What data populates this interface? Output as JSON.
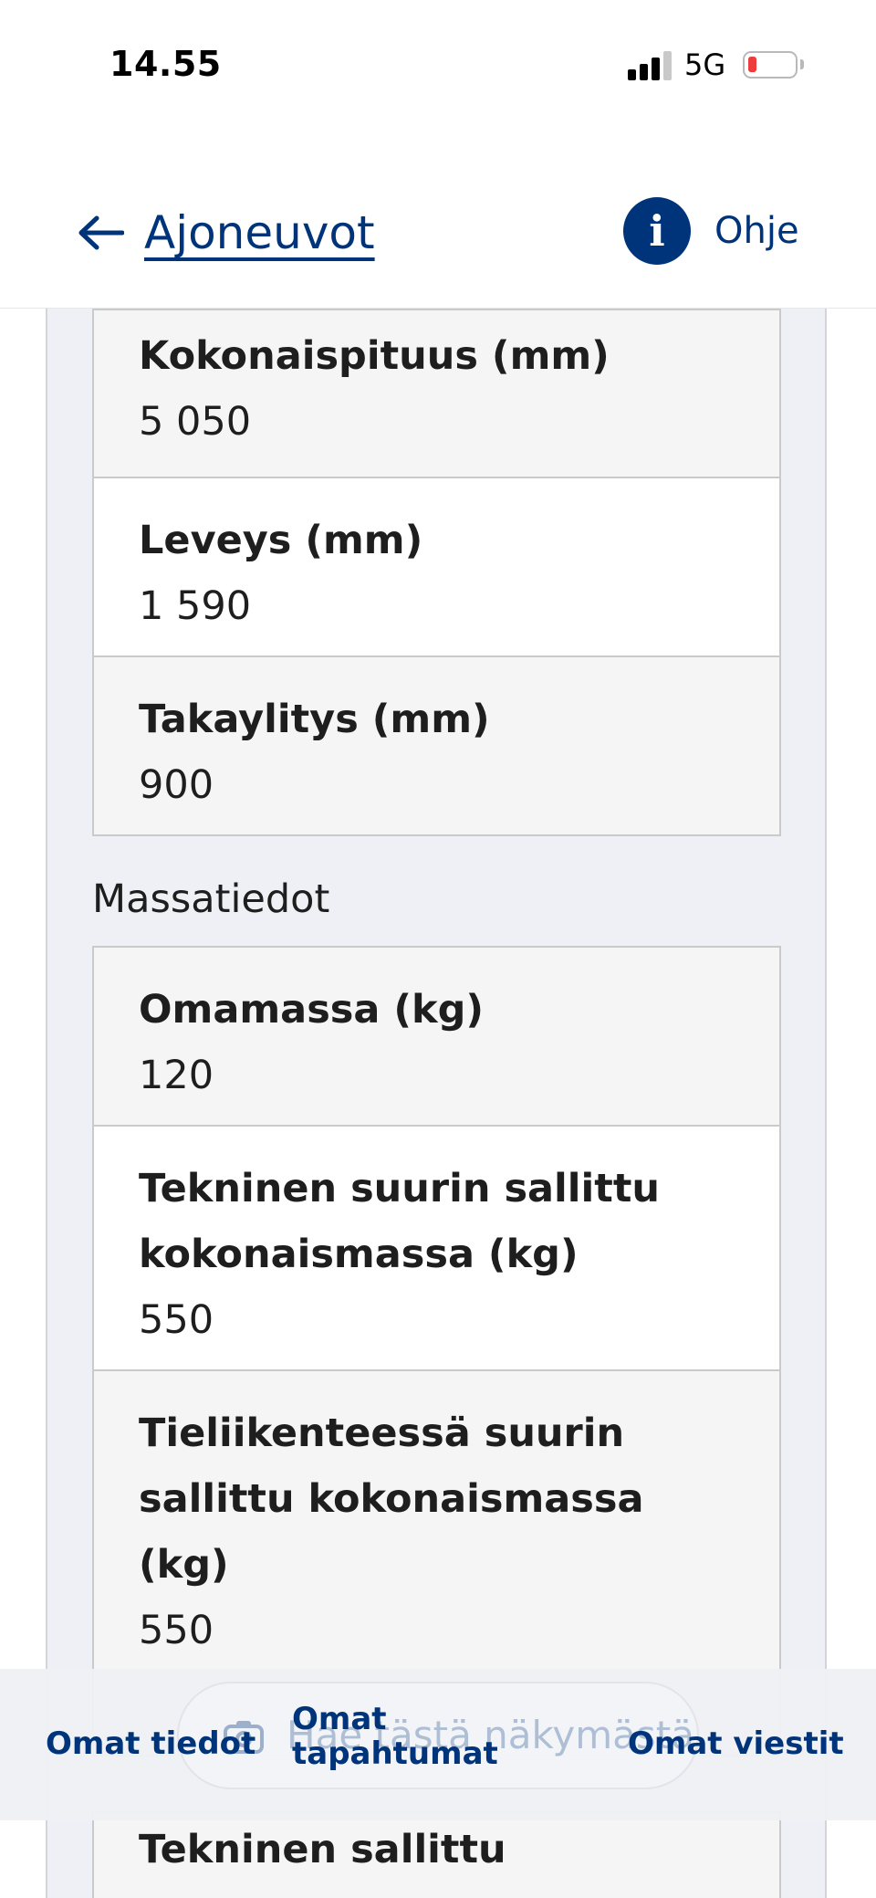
{
  "status_bar": {
    "time": "14.55",
    "network": "5G",
    "battery_level": 0.1,
    "battery_color": "#ee3b3b",
    "signal_bars_filled": 3,
    "signal_bars_total": 4
  },
  "header": {
    "back_label": "Ajoneuvot",
    "back_icon": "arrow-left-icon",
    "help_label": "Ohje",
    "help_icon": "info-icon",
    "accent_color": "#00347a"
  },
  "dimensions_table": {
    "rows": [
      {
        "label": "Kokonaispituus (mm)",
        "value": "5 050"
      },
      {
        "label": "Leveys (mm)",
        "value": "1 590"
      },
      {
        "label": "Takaylitys (mm)",
        "value": "900"
      }
    ]
  },
  "mass_section": {
    "title": "Massatiedot",
    "rows": [
      {
        "label": "Omamassa (kg)",
        "value": "120"
      },
      {
        "label": "Tekninen suurin sallittu kokonaismassa (kg)",
        "value": "550"
      },
      {
        "label": "Tieliikenteessä suurin sallittu kokonaismassa (kg)",
        "value": "550"
      }
    ]
  },
  "next_table": {
    "rows": [
      {
        "label": "Tekninen sallittu"
      }
    ]
  },
  "bottom_nav": {
    "search_placeholder": "Hae tästä näkymästä",
    "search_icon": "camera-search-icon",
    "left_label": "Omat tiedot",
    "center_label_line1": "Omat",
    "center_label_line2": "tapahtumat",
    "right_label": "Omat viestit"
  }
}
